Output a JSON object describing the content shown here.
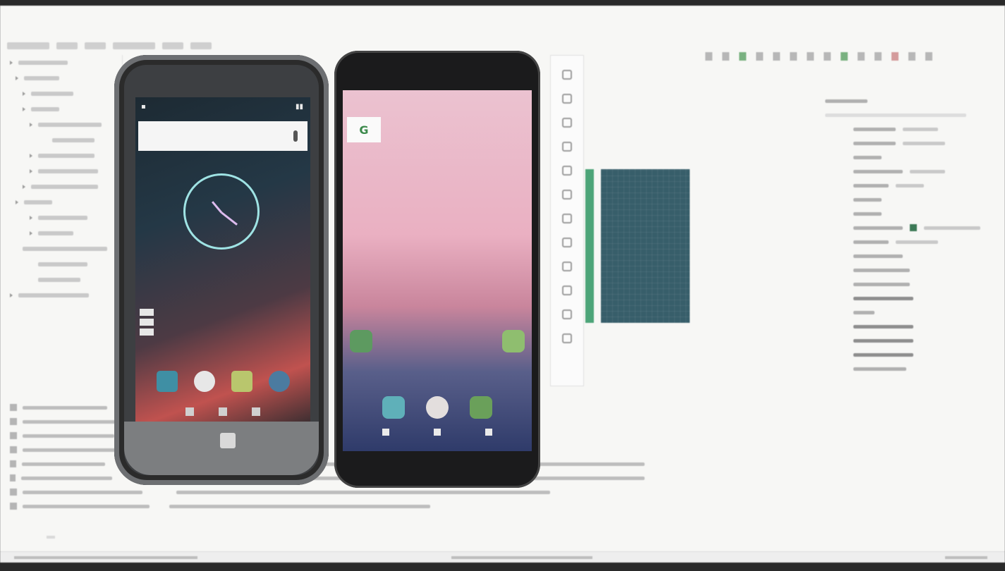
{
  "ide": {
    "menu": [
      "",
      "",
      "",
      "",
      "",
      "",
      "",
      "",
      "",
      ""
    ],
    "design": {
      "title": ""
    },
    "attributes": {
      "title": ""
    },
    "bottom_tabs": [
      "",
      "",
      "",
      "",
      ""
    ],
    "status_text": ""
  },
  "phones": {
    "left": {
      "search_placeholder": "",
      "dock_colors": [
        "#3f8fa4",
        "#e7e7e7",
        "#b9c66d",
        "#4b7ba0"
      ]
    },
    "right": {
      "home_icon_colors": [
        "#5d9a60",
        "#8fbe6f"
      ],
      "dock_colors": [
        "#5fb0b9",
        "#e3dedd",
        "#6aa05a"
      ]
    }
  },
  "colors": {
    "blueprint": "#355e6b",
    "green_accent": "#49a577"
  }
}
